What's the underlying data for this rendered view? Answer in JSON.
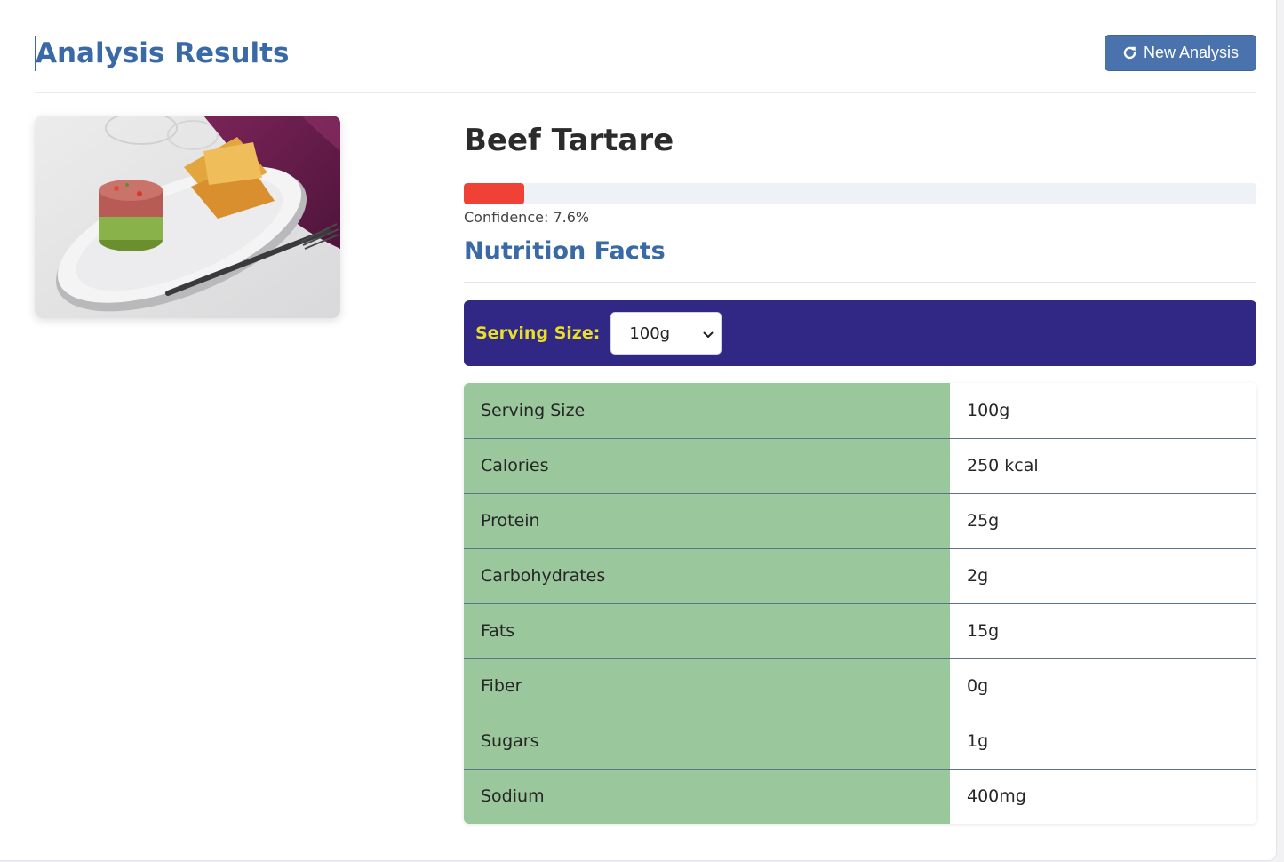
{
  "header": {
    "title": "Analysis Results",
    "new_analysis_label": "New Analysis",
    "new_analysis_icon": "refresh-icon"
  },
  "image": {
    "alt": "Beef Tartare"
  },
  "result": {
    "food_name": "Beef Tartare",
    "confidence": 0.076,
    "confidence_text": "Confidence: 7.6%",
    "confidence_color": "#ef4136"
  },
  "nutrition": {
    "title": "Nutrition Facts",
    "serving_label": "Serving Size:",
    "serving_selected": "100g",
    "rows": [
      {
        "label": "Serving Size",
        "value": "100g"
      },
      {
        "label": "Calories",
        "value": "250 kcal"
      },
      {
        "label": "Protein",
        "value": "25g"
      },
      {
        "label": "Carbohydrates",
        "value": "2g"
      },
      {
        "label": "Fats",
        "value": "15g"
      },
      {
        "label": "Fiber",
        "value": "0g"
      },
      {
        "label": "Sugars",
        "value": "1g"
      },
      {
        "label": "Sodium",
        "value": "400mg"
      }
    ]
  },
  "colors": {
    "accent": "#3a6aa6",
    "button": "#4a73ad",
    "serving_bar": "#312785",
    "serving_label": "#e8df27",
    "label_cell": "#9bc79c"
  }
}
